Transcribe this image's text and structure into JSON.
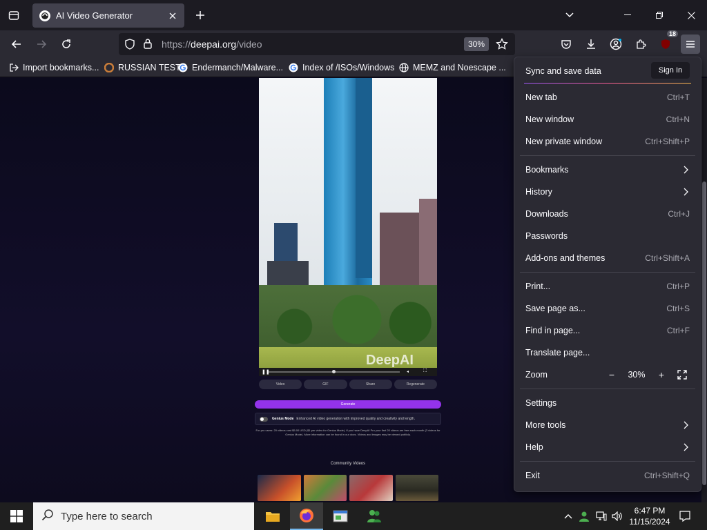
{
  "tab": {
    "title": "AI Video Generator"
  },
  "url": {
    "host_prefix": "https://",
    "host": "deepai.org",
    "path": "/video"
  },
  "zoom_badge": "30%",
  "extension_badge": "18",
  "bookmarks": [
    {
      "label": "Import bookmarks...",
      "icon": "import-icon"
    },
    {
      "label": "RUSSIAN TEST",
      "icon": "site-icon"
    },
    {
      "label": "Endermanch/Malware...",
      "icon": "google-icon"
    },
    {
      "label": "Index of /ISOs/Windows",
      "icon": "google-icon"
    },
    {
      "label": "MEMZ and Noescape ...",
      "icon": "globe-icon"
    }
  ],
  "page": {
    "watermark": "DeepAI",
    "actions": [
      "Video",
      "GIF",
      "Share",
      "Regenerate"
    ],
    "generate_label": "Generate",
    "genius_title": "Genius Mode",
    "genius_desc": "Enhanced AI video generation with improved quality and creativity and length.",
    "fineprint": "For pro users: 20 videos cost $5.00 USD ($1 per video for Genius Mode). If you have DeepAI Pro your first 20 videos are free each month (3 videos for Genius Mode). More information can be found in our docs. Videos and images may be viewed publicly.",
    "community_title": "Community Videos"
  },
  "menu": {
    "sync_label": "Sync and save data",
    "signin_label": "Sign In",
    "items": [
      {
        "label": "New tab",
        "shortcut": "Ctrl+T"
      },
      {
        "label": "New window",
        "shortcut": "Ctrl+N"
      },
      {
        "label": "New private window",
        "shortcut": "Ctrl+Shift+P"
      },
      {
        "label": "Bookmarks",
        "shortcut": ""
      },
      {
        "label": "History",
        "shortcut": ""
      },
      {
        "label": "Downloads",
        "shortcut": "Ctrl+J"
      },
      {
        "label": "Passwords",
        "shortcut": ""
      },
      {
        "label": "Add-ons and themes",
        "shortcut": "Ctrl+Shift+A"
      },
      {
        "label": "Print...",
        "shortcut": "Ctrl+P"
      },
      {
        "label": "Save page as...",
        "shortcut": "Ctrl+S"
      },
      {
        "label": "Find in page...",
        "shortcut": "Ctrl+F"
      },
      {
        "label": "Translate page...",
        "shortcut": ""
      },
      {
        "label": "Zoom",
        "shortcut": ""
      },
      {
        "label": "Settings",
        "shortcut": ""
      },
      {
        "label": "More tools",
        "shortcut": ""
      },
      {
        "label": "Help",
        "shortcut": ""
      },
      {
        "label": "Exit",
        "shortcut": "Ctrl+Shift+Q"
      }
    ],
    "zoom_value": "30%",
    "zoom_minus": "−",
    "zoom_plus": "+"
  },
  "taskbar": {
    "search_placeholder": "Type here to search",
    "time": "6:47 PM",
    "date": "11/15/2024"
  },
  "colors": {
    "accent": "#9333ea",
    "menu_bg": "#2b2a33",
    "toolbar": "#2b2a33",
    "tabbar": "#1c1b22"
  }
}
